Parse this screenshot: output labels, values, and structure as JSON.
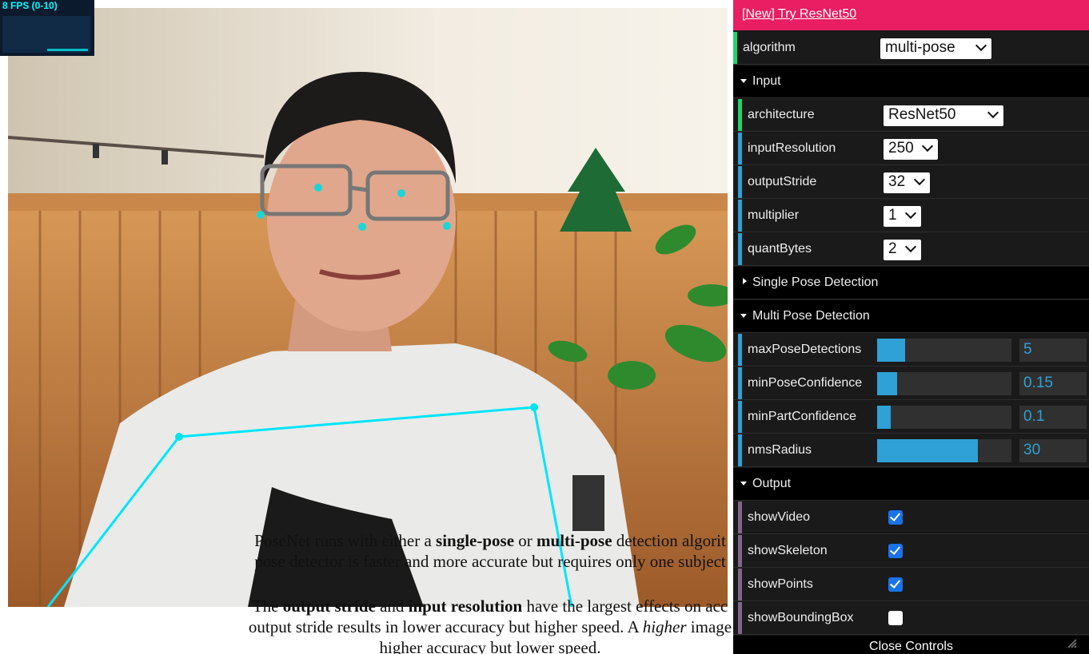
{
  "fps": {
    "text": "8 FPS (0-10)"
  },
  "description": {
    "p1": [
      {
        "t": "PoseNet runs with either a ",
        "b": false
      },
      {
        "t": "single-pose",
        "b": true
      },
      {
        "t": " or ",
        "b": false
      },
      {
        "t": "multi-pose",
        "b": true
      },
      {
        "t": " detection algorit",
        "b": false
      }
    ],
    "p1_line2": "pose detector is faster and more accurate but requires only one subject",
    "p2": [
      {
        "t": "The ",
        "b": false
      },
      {
        "t": "output stride",
        "b": true
      },
      {
        "t": " and ",
        "b": false
      },
      {
        "t": "input resolution",
        "b": true
      },
      {
        "t": " have the largest effects on acc",
        "b": false
      }
    ],
    "p2_line2a": "output stride results in lower accuracy but higher speed. A ",
    "p2_line2b": "higher",
    "p2_line2c": " image",
    "p2_line3": "higher accuracy but lower speed."
  },
  "panel": {
    "banner_link": "[New] Try ResNet50",
    "algorithm": {
      "label": "algorithm",
      "value": "multi-pose"
    },
    "input_folder": "Input",
    "input": [
      {
        "label": "architecture",
        "value": "ResNet50"
      },
      {
        "label": "inputResolution",
        "value": "250"
      },
      {
        "label": "outputStride",
        "value": "32"
      },
      {
        "label": "multiplier",
        "value": "1"
      },
      {
        "label": "quantBytes",
        "value": "2"
      }
    ],
    "single_folder": "Single Pose Detection",
    "multi_folder": "Multi Pose Detection",
    "multi": [
      {
        "label": "maxPoseDetections",
        "value": "5",
        "fill": 0.21
      },
      {
        "label": "minPoseConfidence",
        "value": "0.15",
        "fill": 0.15
      },
      {
        "label": "minPartConfidence",
        "value": "0.1",
        "fill": 0.1
      },
      {
        "label": "nmsRadius",
        "value": "30",
        "fill": 0.75
      }
    ],
    "output_folder": "Output",
    "output": [
      {
        "label": "showVideo",
        "checked": true
      },
      {
        "label": "showSkeleton",
        "checked": true
      },
      {
        "label": "showPoints",
        "checked": true
      },
      {
        "label": "showBoundingBox",
        "checked": false
      }
    ],
    "close_label": "Close Controls"
  },
  "colors": {
    "accent": "#2fa1d6",
    "banner": "#e91e63",
    "keypoint": "#00e5e5",
    "skeleton": "#00e5ff"
  }
}
